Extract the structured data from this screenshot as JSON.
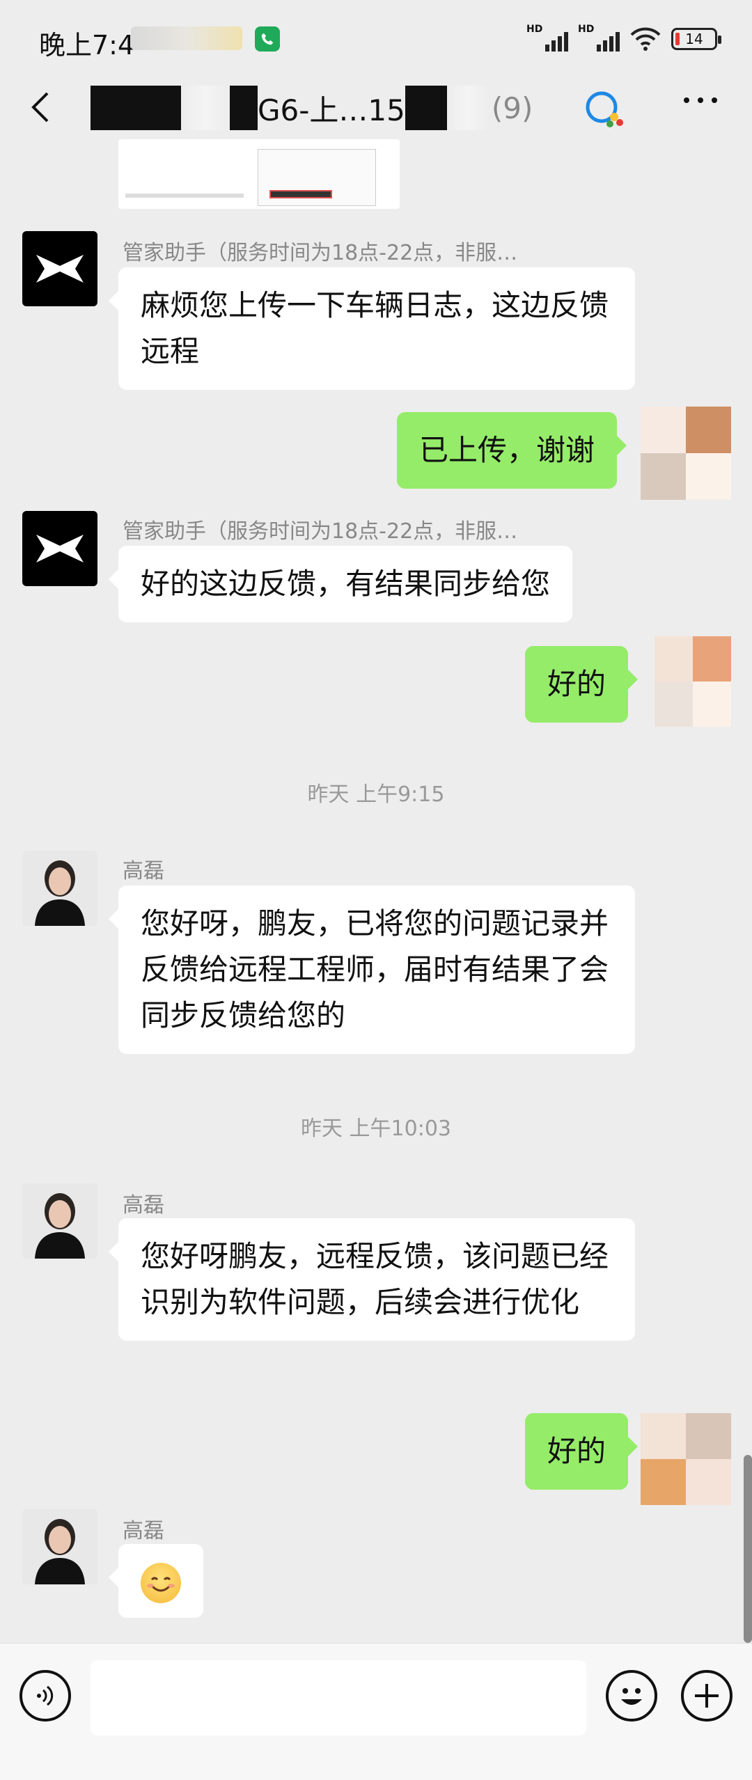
{
  "status_bar": {
    "time": "晚上7:4",
    "battery": "14",
    "signal_badge_1": "HD",
    "signal_badge_2": "HD"
  },
  "header": {
    "title_visible": "G6-上…15",
    "member_count": "(9)"
  },
  "messages": [
    {
      "sender": "管家助手（服务时间为18点-22点，非服…",
      "text": "麻烦您上传一下车辆日志，这边反馈远程",
      "side": "left",
      "avatar": "xpeng-logo-icon"
    },
    {
      "text": "已上传，谢谢",
      "side": "right"
    },
    {
      "sender": "管家助手（服务时间为18点-22点，非服…",
      "text": "好的这边反馈，有结果同步给您",
      "side": "left",
      "avatar": "xpeng-logo-icon"
    },
    {
      "text": "好的",
      "side": "right"
    },
    {
      "sender": "高磊",
      "text": "您好呀，鹏友，已将您的问题记录并反馈给远程工程师，届时有结果了会同步反馈给您的",
      "side": "left"
    },
    {
      "sender": "高磊",
      "text": "您好呀鹏友，远程反馈，该问题已经识别为软件问题，后续会进行优化",
      "side": "left"
    },
    {
      "text": "好的",
      "side": "right"
    },
    {
      "sender": "高磊",
      "emoji": "smile-emoji",
      "side": "left"
    }
  ],
  "timestamps": [
    "昨天 上午9:15",
    "昨天 上午10:03"
  ],
  "input_bar": {
    "placeholder": ""
  },
  "colors": {
    "background": "#ededed",
    "my_bubble": "#95ec69",
    "their_bubble": "#ffffff"
  }
}
